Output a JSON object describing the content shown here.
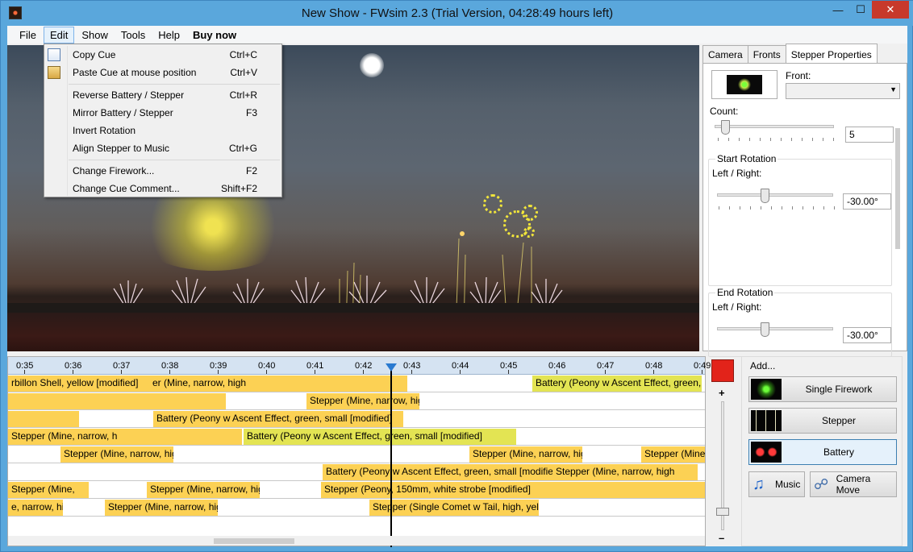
{
  "window": {
    "title": "New Show - FWsim 2.3 (Trial Version, 04:28:49 hours left)"
  },
  "menubar": [
    {
      "label": "File"
    },
    {
      "label": "Edit"
    },
    {
      "label": "Show"
    },
    {
      "label": "Tools"
    },
    {
      "label": "Help"
    },
    {
      "label": "Buy now"
    }
  ],
  "edit_menu": {
    "items": [
      {
        "label": "Copy Cue",
        "shortcut": "Ctrl+C"
      },
      {
        "label": "Paste Cue at mouse position",
        "shortcut": "Ctrl+V"
      },
      {
        "label": "Reverse Battery / Stepper",
        "shortcut": "Ctrl+R"
      },
      {
        "label": "Mirror Battery / Stepper",
        "shortcut": "F3"
      },
      {
        "label": "Invert Rotation",
        "shortcut": ""
      },
      {
        "label": "Align Stepper to Music",
        "shortcut": "Ctrl+G"
      },
      {
        "label": "Change Firework...",
        "shortcut": "F2"
      },
      {
        "label": "Change Cue Comment...",
        "shortcut": "Shift+F2"
      }
    ]
  },
  "tabs": [
    {
      "label": "Camera"
    },
    {
      "label": "Fronts"
    },
    {
      "label": "Stepper Properties"
    }
  ],
  "stepper_properties": {
    "front_label": "Front:",
    "count_label": "Count:",
    "count_value": "5",
    "start_rotation": {
      "title": "Start Rotation",
      "label": "Left / Right:",
      "value": "-30.00°"
    },
    "end_rotation": {
      "title": "End Rotation",
      "label": "Left / Right:",
      "value": "-30.00°"
    }
  },
  "timeline": {
    "ticks": [
      "0:35",
      "0:36",
      "0:37",
      "0:38",
      "0:39",
      "0:40",
      "0:41",
      "0:42",
      "0:43",
      "0:44",
      "0:45",
      "0:46",
      "0:47",
      "0:48",
      "0:49"
    ],
    "rows": [
      {
        "cues": [
          {
            "label": "rbillon Shell, yellow [modified]"
          },
          {
            "label": "er (Mine, narrow, high"
          },
          {
            "label": "Battery (Peony w Ascent Effect, green, small [modified]"
          }
        ]
      },
      {
        "cues": [
          {
            "label": ""
          },
          {
            "label": "Stepper (Mine, narrow, high"
          }
        ]
      },
      {
        "cues": [
          {
            "label": ""
          },
          {
            "label": "Battery (Peony w Ascent Effect, green, small [modified]"
          }
        ]
      },
      {
        "cues": [
          {
            "label": "Stepper (Mine, narrow, h"
          },
          {
            "label": "Battery (Peony w Ascent Effect, green, small [modified]"
          }
        ]
      },
      {
        "cues": [
          {
            "label": "Stepper (Mine, narrow, high"
          },
          {
            "label": "Stepper (Mine, narrow, high"
          },
          {
            "label": "Stepper (Mine,"
          }
        ]
      },
      {
        "cues": [
          {
            "label": "Battery (Peony w Ascent Effect, green, small [modified]"
          },
          {
            "label": "Stepper (Mine, narrow, high"
          }
        ]
      },
      {
        "cues": [
          {
            "label": "e, narrow, high"
          },
          {
            "label": "Stepper (Mine, narrow, high"
          },
          {
            "label": "Stepper (Peony, 150mm, white strobe [modified]"
          },
          {
            "label": "Stepper (Mine,"
          }
        ]
      },
      {
        "cues": [
          {
            "label": "e, narrow, high"
          },
          {
            "label": "Stepper (Mine, narrow, high"
          },
          {
            "label": "Stepper (Single Comet w Tail, high, yellow [m"
          }
        ]
      }
    ]
  },
  "zoom": {
    "plus": "+",
    "minus": "–"
  },
  "add_panel": {
    "title": "Add...",
    "buttons": [
      {
        "label": "Single Firework"
      },
      {
        "label": "Stepper"
      },
      {
        "label": "Battery"
      }
    ],
    "music_label": "Music",
    "camera_move_label": "Camera Move"
  }
}
